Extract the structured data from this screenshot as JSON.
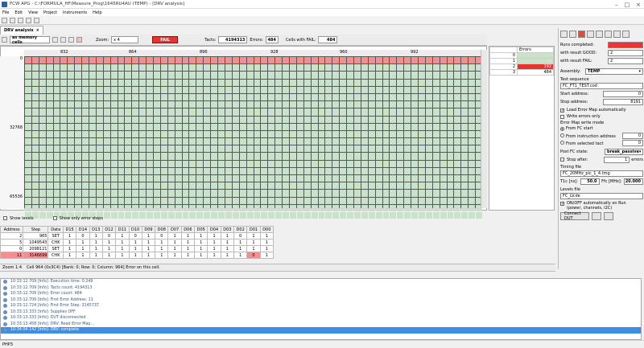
{
  "window": {
    "title": "FCW APG - C:\\FORMULA_HF\\Measure_Prog\\1645RU4AU (TEMP) - [DRV analysis]"
  },
  "menu": [
    "File",
    "Edit",
    "View",
    "Project",
    "Instruments",
    "Help"
  ],
  "tab": {
    "label": "DRV analysis"
  },
  "controls": {
    "mode": "as memory cells",
    "zoom_label": "Zoom:",
    "zoom_value": "x 4",
    "result": "FAIL",
    "tacts_label": "Tacts:",
    "tacts": "4194313",
    "errors_label": "Errors:",
    "errors": "484",
    "cells_fail_label": "Cells with FAIL:",
    "cells_fail": "484"
  },
  "grid": {
    "x_ticks": [
      "832",
      "864",
      "896",
      "928",
      "960",
      "992"
    ],
    "y_ticks": [
      "0",
      "32768",
      "65536"
    ]
  },
  "err_panel": {
    "header": "Errors",
    "rows": [
      {
        "idx": "0",
        "val": "",
        "color": "#c8e3c8"
      },
      {
        "idx": "1",
        "val": "",
        "color": "#c8e3c8"
      },
      {
        "idx": "2",
        "val": "192",
        "color": "#e63434"
      },
      {
        "idx": "3",
        "val": "484",
        "color": "#ffffff"
      }
    ]
  },
  "options": {
    "show_levels": "Show levels",
    "show_error_steps": "Show only error steps"
  },
  "dtable": {
    "headers": [
      "Address",
      "Step",
      "Data",
      "D15",
      "D14",
      "D13",
      "D12",
      "D11",
      "D10",
      "D09",
      "D08",
      "D07",
      "D06",
      "D05",
      "D04",
      "D03",
      "D02",
      "D01",
      "D00"
    ],
    "rows": [
      [
        "2",
        "965",
        "SET",
        "1",
        "0",
        "1",
        "0",
        "1",
        "0",
        "1",
        "0",
        "1",
        "1",
        "1",
        "1",
        "1",
        "0",
        "1",
        "1"
      ],
      [
        "5",
        "1049543",
        "CHK",
        "1",
        "1",
        "1",
        "1",
        "1",
        "1",
        "1",
        "1",
        "1",
        "1",
        "1",
        "1",
        "1",
        "1",
        "1",
        "1"
      ],
      [
        "0",
        "2098121",
        "SET",
        "1",
        "1",
        "1",
        "1",
        "1",
        "1",
        "1",
        "1",
        "1",
        "1",
        "1",
        "1",
        "1",
        "1",
        "1",
        "1"
      ],
      [
        "11",
        "3146699",
        "CHK",
        "1",
        "1",
        "1",
        "1",
        "1",
        "1",
        "1",
        "1",
        "1",
        "1",
        "1",
        "1",
        "1",
        "1",
        "0",
        "1"
      ]
    ]
  },
  "status": {
    "zoom": "Zoom 1:4",
    "cell_info": "Cell 964 (0x3C4) [Bank: 0; Row: 0; Column: 964] Error on this cell:"
  },
  "right": {
    "runs_completed": "Runs completed:",
    "runs_val": "",
    "with_good": "with result GOOD:",
    "good_val": "2",
    "with_fail": "with result FAIL:",
    "fail_val": "2",
    "assembly_label": "Assembly:",
    "assembly": "TEMP",
    "test_seq_label": "Test sequence",
    "test_seq": "FC_FT1_TEST.cod",
    "start_addr_label": "Start address:",
    "start_addr": "0",
    "stop_addr_label": "Stop address:",
    "stop_addr": "8191",
    "load_err_map": "Load Error Map automatically",
    "write_err_only": "Write errors only",
    "err_map_mode": "Error Map write mode",
    "from_fc_start": "From FC start",
    "from_instr": "From instruction address",
    "from_instr_val": "0",
    "from_tact": "From selected tact",
    "from_tact_val": "0",
    "post_fc_label": "Post FC state:",
    "post_fc": "break_passive",
    "stop_after": "Stop after:",
    "stop_after_val": "1",
    "errors_word": "errors",
    "timing_label": "Timing file",
    "timing": "FC_20MHz_pic_1_4.tmg",
    "t1c_label": "T1c [ns]:",
    "t1c": "50.0",
    "ffc_label": "Ffc [MHz]:",
    "ffc": "20.000",
    "levels_label": "Levels file",
    "levels": "FC_LV.de",
    "onoff": "ON/OFF automatically on Run",
    "onoff2": "(power, channels, I2C)",
    "connect": "Connect DUT"
  },
  "log": [
    "10:33:12.709 [Info]: Execution time: 0.249",
    "10:33:12.709 [Info]:     Tacts count: 4194313",
    "10:33:12.709 [Info]:     Error count: 484",
    "10:33:12.709 [Info]:     First Error Address: 11",
    "10:33:12.724 [Info]:     First Error Step: 3145737",
    "10:33:13.333 [Info]: Supplies OFF",
    "10:33:13.333 [Info]: DUT disconnected",
    "10:33:13.458 [Info]: DRV: Read Error Map...",
    "10:34:04.142 [Info]: DRV: complete"
  ],
  "bottom": {
    "text": "PHP3"
  }
}
